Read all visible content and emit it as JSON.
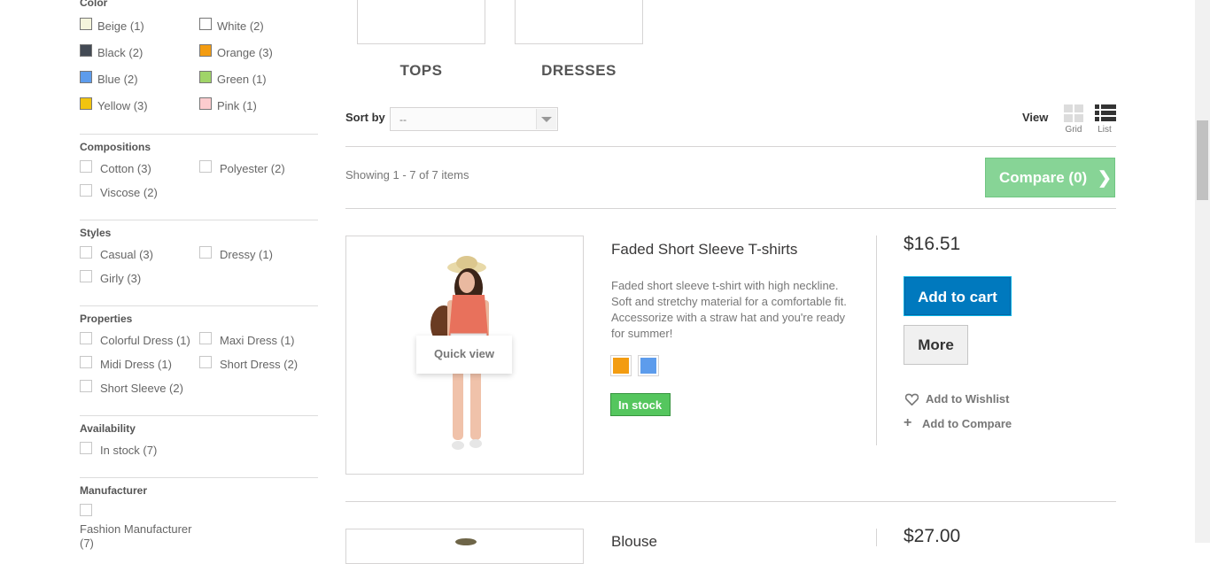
{
  "filters": {
    "color": {
      "title": "Color",
      "options": [
        {
          "label": "Beige (1)",
          "color": "#f5f5dc"
        },
        {
          "label": "White (2)",
          "color": "#ffffff"
        },
        {
          "label": "Black (2)",
          "color": "#434a54"
        },
        {
          "label": "Orange (3)",
          "color": "#f39c11"
        },
        {
          "label": "Blue (2)",
          "color": "#5d9cec"
        },
        {
          "label": "Green (1)",
          "color": "#a0d468"
        },
        {
          "label": "Yellow (3)",
          "color": "#f1c40f"
        },
        {
          "label": "Pink (1)",
          "color": "#fcccce"
        }
      ]
    },
    "compositions": {
      "title": "Compositions",
      "options": [
        "Cotton (3)",
        "Polyester (2)",
        "Viscose (2)"
      ]
    },
    "styles": {
      "title": "Styles",
      "options": [
        "Casual (3)",
        "Dressy (1)",
        "Girly (3)"
      ]
    },
    "properties": {
      "title": "Properties",
      "options": [
        "Colorful Dress (1)",
        "Maxi Dress (1)",
        "Midi Dress (1)",
        "Short Dress (2)",
        "Short Sleeve (2)"
      ]
    },
    "availability": {
      "title": "Availability",
      "options": [
        "In stock (7)"
      ]
    },
    "manufacturer": {
      "title": "Manufacturer",
      "options": [
        "Fashion Manufacturer",
        "(7)"
      ]
    }
  },
  "subcategories": [
    "TOPS",
    "DRESSES"
  ],
  "toolbar": {
    "sort_label": "Sort by",
    "sort_value": "--",
    "view_label": "View",
    "grid_label": "Grid",
    "list_label": "List",
    "showing": "Showing 1 - 7 of 7 items",
    "compare_label": "Compare (0)"
  },
  "products": [
    {
      "name": "Faded Short Sleeve T-shirts",
      "description": "Faded short sleeve t-shirt with high neckline. Soft and stretchy material for a comfortable fit. Accessorize with a straw hat and you're ready for summer!",
      "price": "$16.51",
      "colors": [
        "#f39c11",
        "#5d9cec"
      ],
      "stock": "In stock",
      "quick_view": "Quick view",
      "add_to_cart": "Add to cart",
      "more": "More",
      "wishlist": "Add to Wishlist",
      "compare": "Add to Compare"
    },
    {
      "name": "Blouse",
      "price": "$27.00"
    }
  ],
  "theme": {
    "accent_blue": "#0079be",
    "stock_green": "#55c65e",
    "compare_green": "#87d496"
  }
}
